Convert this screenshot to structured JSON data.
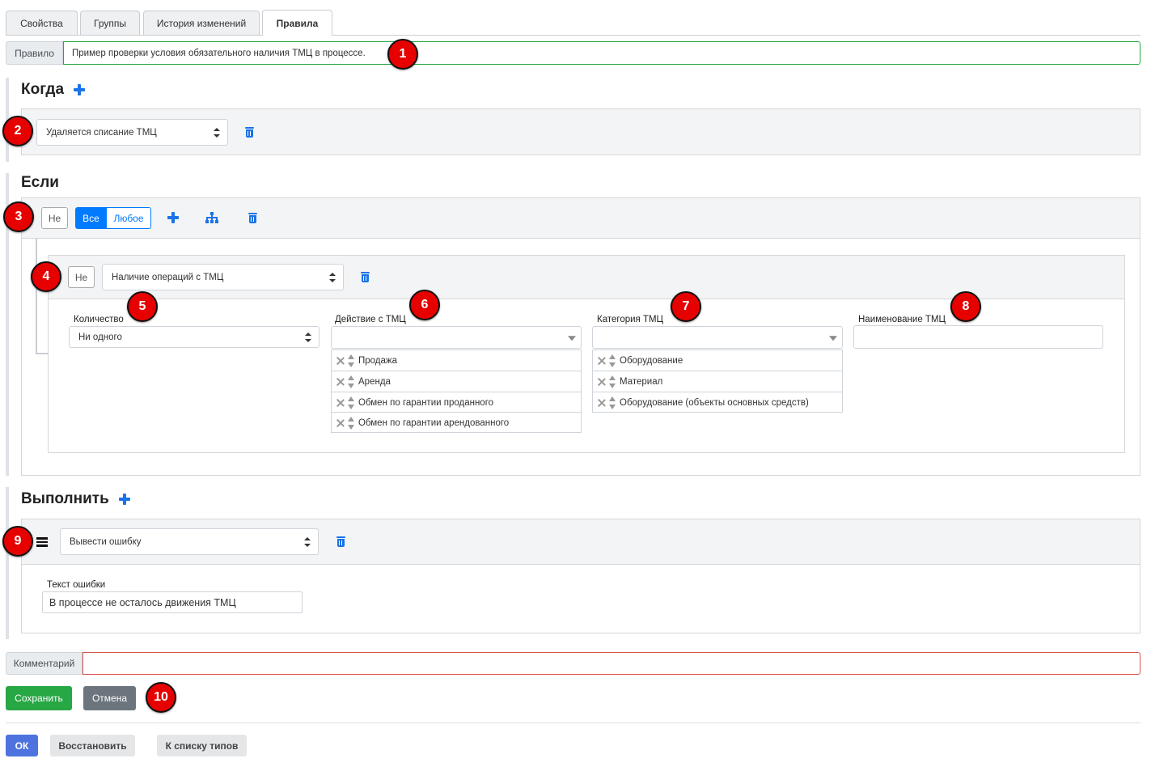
{
  "tabs": [
    {
      "label": "Свойства",
      "active": false
    },
    {
      "label": "Группы",
      "active": false
    },
    {
      "label": "История изменений",
      "active": false
    },
    {
      "label": "Правила",
      "active": true
    }
  ],
  "rule": {
    "label": "Правило",
    "value": "Пример проверки условия обязательного наличия ТМЦ в процессе."
  },
  "when": {
    "title": "Когда",
    "event_value": "Удаляется списание ТМЦ"
  },
  "if": {
    "title": "Если",
    "not_label": "Не",
    "all_label": "Все",
    "any_label": "Любое",
    "condition": {
      "not_label": "Не",
      "type_value": "Наличие операций с ТМЦ",
      "quantity": {
        "label": "Количество",
        "value": "Ни одного"
      },
      "action": {
        "label": "Действие с ТМЦ",
        "items": [
          "Продажа",
          "Аренда",
          "Обмен по гарантии проданного",
          "Обмен по гарантии арендованного"
        ]
      },
      "category": {
        "label": "Категория ТМЦ",
        "items": [
          "Оборудование",
          "Материал",
          "Оборудование (объекты основных средств)"
        ]
      },
      "name": {
        "label": "Наименование ТМЦ",
        "value": ""
      }
    }
  },
  "execute": {
    "title": "Выполнить",
    "action_value": "Вывести ошибку",
    "error_label": "Текст ошибки",
    "error_value": "В процессе не осталось движения ТМЦ"
  },
  "comment": {
    "label": "Комментарий",
    "value": ""
  },
  "buttons": {
    "save": "Сохранить",
    "cancel": "Отмена",
    "ok": "ОК",
    "restore": "Восстановить",
    "to_types": "К списку типов"
  },
  "badges": [
    "1",
    "2",
    "3",
    "4",
    "5",
    "6",
    "7",
    "8",
    "9",
    "10"
  ],
  "colors": {
    "primary": "#007bff",
    "success": "#28a745",
    "secondary": "#6c757d",
    "badge": "#e60000",
    "ok_button": "#4e73df"
  },
  "icons": {
    "add": "plus-icon",
    "delete": "trash-icon",
    "group": "sitemap-icon",
    "drag": "menu-icon",
    "remove_item": "close-icon",
    "reorder": "sort-icon"
  }
}
